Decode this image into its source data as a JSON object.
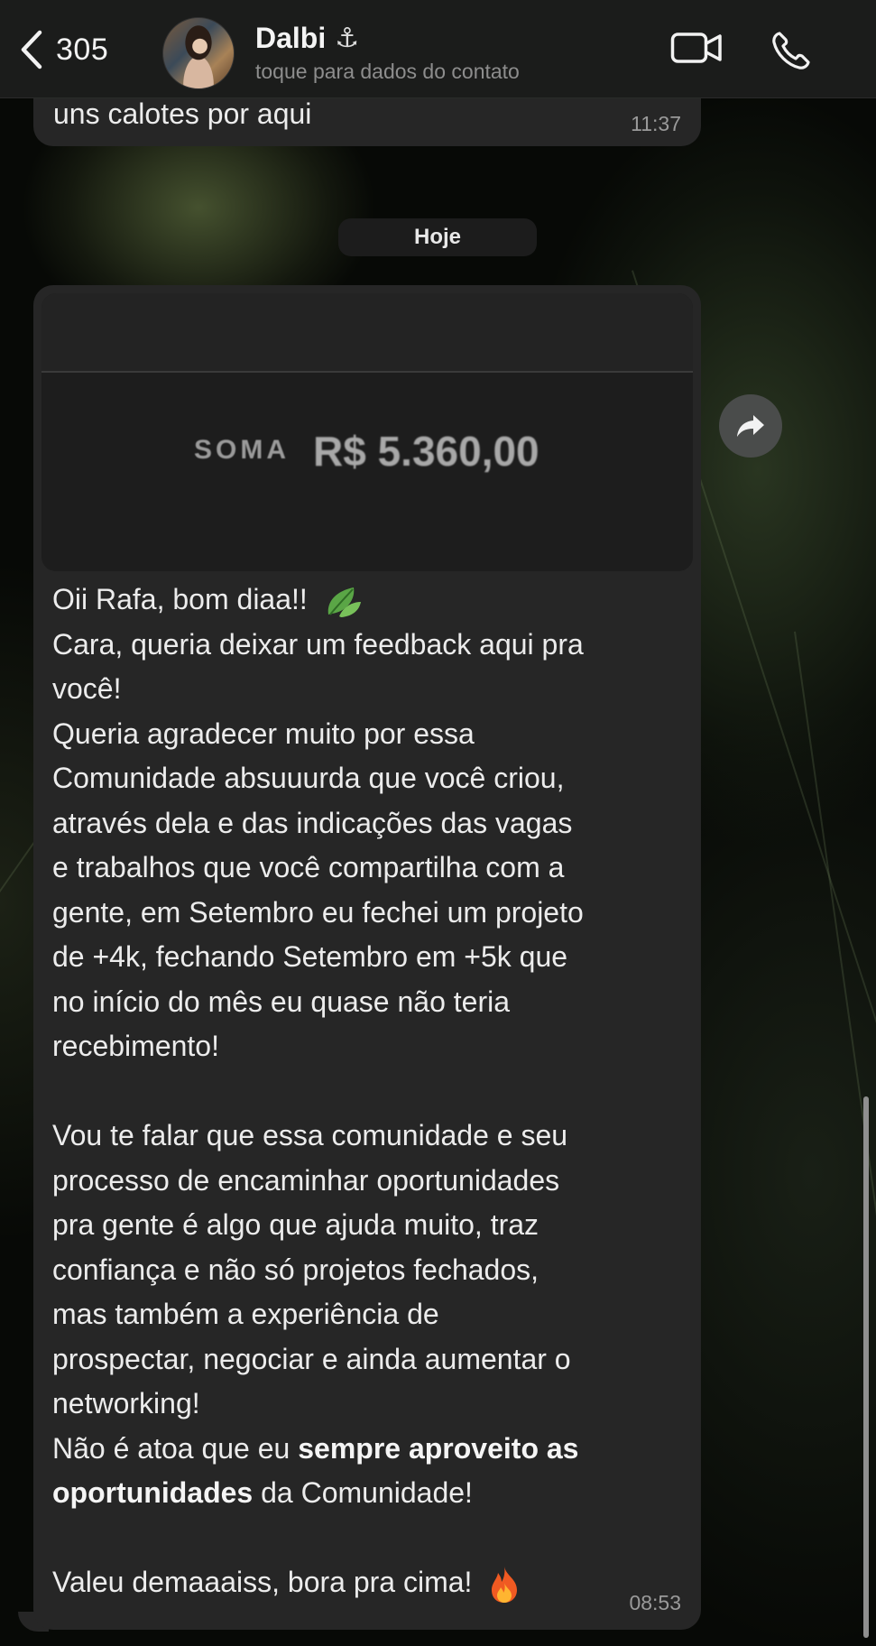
{
  "header": {
    "back_count": "305",
    "contact_name": "Dalbi",
    "name_symbol": "⚓",
    "subtitle": "toque para dados do contato",
    "icons": [
      "back-chevron-icon",
      "video-camera-icon",
      "phone-icon"
    ]
  },
  "previous_message": {
    "text": "uns calotes por aqui",
    "time": "11:37"
  },
  "date_divider": "Hoje",
  "message": {
    "image": {
      "label": "SOMA",
      "value": "R$ 5.360,00"
    },
    "lines": {
      "l1": "Oii Rafa, bom diaa!!",
      "l2": "Cara, queria deixar um feedback aqui pra",
      "l3": "você!",
      "l4": "Queria agradecer muito por essa",
      "l5": "Comunidade absuuurda que você criou,",
      "l6": "através dela e das indicações das vagas",
      "l7": "e trabalhos que você compartilha com a",
      "l8": "gente, em Setembro eu fechei um projeto",
      "l9": "de +4k, fechando Setembro em +5k que",
      "l10": "no início do mês eu quase não teria",
      "l11": "recebimento!",
      "l12": "Vou te falar que essa comunidade e seu",
      "l13": "processo de encaminhar oportunidades",
      "l14": "pra gente é algo que ajuda muito, traz",
      "l15": "confiança e não só projetos fechados,",
      "l16": "mas também a experiência de",
      "l17": "prospectar, negociar e ainda aumentar o",
      "l18": "networking!",
      "l19a": "Não é atoa que eu ",
      "l19b": "sempre aproveito as",
      "l20a": "oportunidades",
      "l20b": " da Comunidade!",
      "l21": "Valeu demaaaiss, bora pra cima!"
    },
    "emojis": [
      "leaf-emoji-icon",
      "fire-emoji-icon"
    ],
    "time": "08:53"
  },
  "forward_icon": "forward-arrow-icon"
}
